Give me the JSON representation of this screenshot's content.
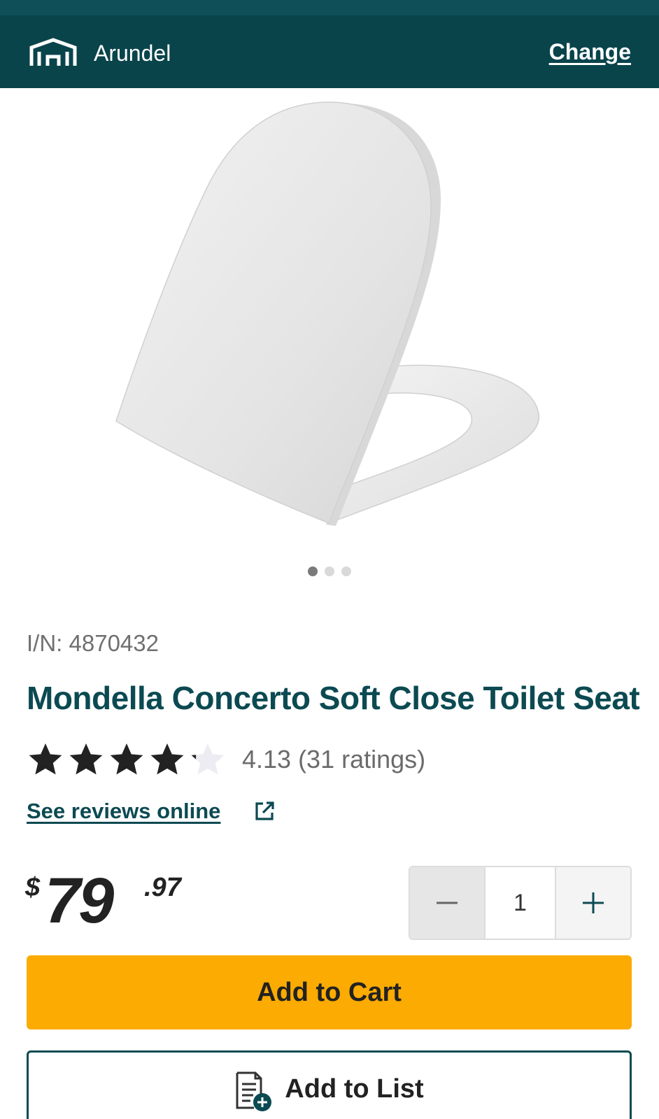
{
  "store": {
    "name": "Arundel",
    "change_label": "Change"
  },
  "carousel": {
    "total": 3,
    "active": 1
  },
  "product": {
    "item_number": "I/N: 4870432",
    "title": "Mondella Concerto Soft Close Toilet Seat",
    "rating_value": 4.13,
    "rating_text": "4.13 (31 ratings)",
    "reviews_link": "See reviews online",
    "price_currency": "$",
    "price_dollars": "79",
    "price_cents": ".97"
  },
  "quantity": {
    "value": "1"
  },
  "actions": {
    "add_to_cart": "Add to Cart",
    "add_to_list": "Add to List"
  },
  "icons": {
    "store": "store-icon",
    "external_link": "external-link-icon",
    "minus": "minus-icon",
    "plus": "plus-icon",
    "add_list": "add-list-icon",
    "star": "star-icon"
  },
  "colors": {
    "header_bg": "#09444b",
    "brand_teal": "#0c4a52",
    "cart_button": "#fbab01",
    "star_fill": "#222222",
    "star_empty": "#ececf2"
  }
}
